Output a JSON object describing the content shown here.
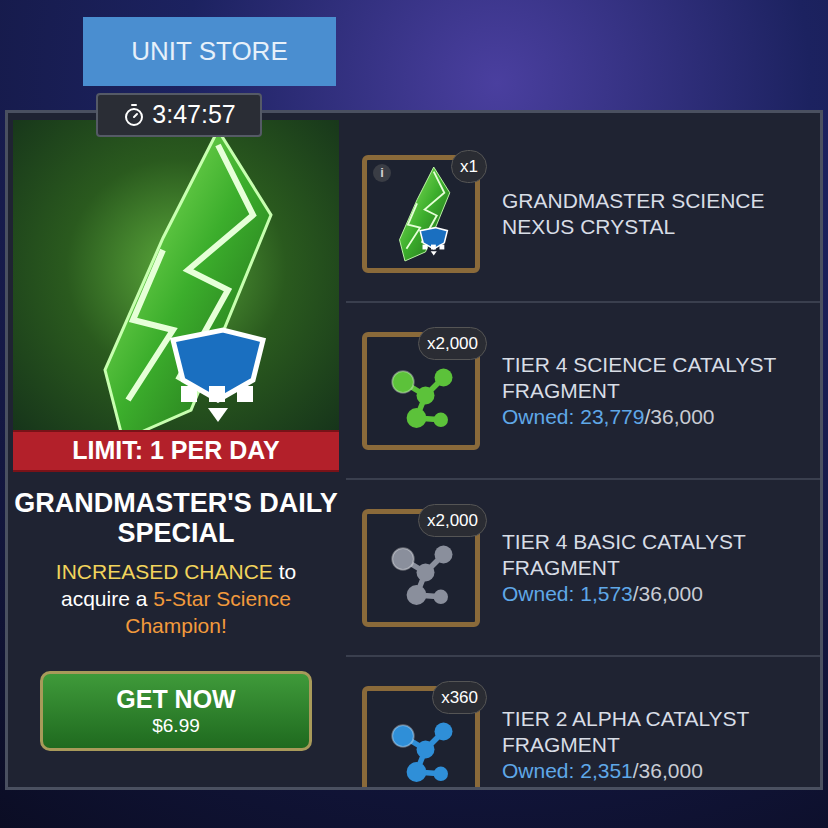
{
  "store_button": "UNIT STORE",
  "timer": "3:47:57",
  "offer": {
    "limit": "LIMIT: 1 PER DAY",
    "title": "GRANDMASTER'S DAILY SPECIAL",
    "description": [
      {
        "text": "INCREASED CHANCE",
        "color": "#f2d45c"
      },
      {
        "text": " to acquire a ",
        "color": "#ffffff"
      },
      {
        "text": "5-Star Science Champion!",
        "color": "#f29a3c"
      }
    ],
    "button": {
      "label": "GET NOW",
      "price": "$6.99"
    }
  },
  "items": [
    {
      "kind": "crystal",
      "name": "GRANDMASTER SCIENCE NEXUS CRYSTAL",
      "quantity": "x1",
      "info": "i",
      "color": "#3fbf3a"
    },
    {
      "kind": "catalyst",
      "name": "TIER 4 SCIENCE CATALYST FRAGMENT",
      "quantity": "x2,000",
      "owned_label": "Owned:",
      "owned": "23,779",
      "max": "/36,000",
      "color": "#5cc23a"
    },
    {
      "kind": "catalyst",
      "name": "TIER 4 BASIC CATALYST FRAGMENT",
      "quantity": "x2,000",
      "owned_label": "Owned:",
      "owned": "1,573",
      "max": "/36,000",
      "color": "#8a8f9c"
    },
    {
      "kind": "catalyst",
      "name": "TIER 2 ALPHA CATALYST FRAGMENT",
      "quantity": "x360",
      "owned_label": "Owned:",
      "owned": "2,351",
      "max": "/36,000",
      "color": "#2f8fd8"
    }
  ]
}
